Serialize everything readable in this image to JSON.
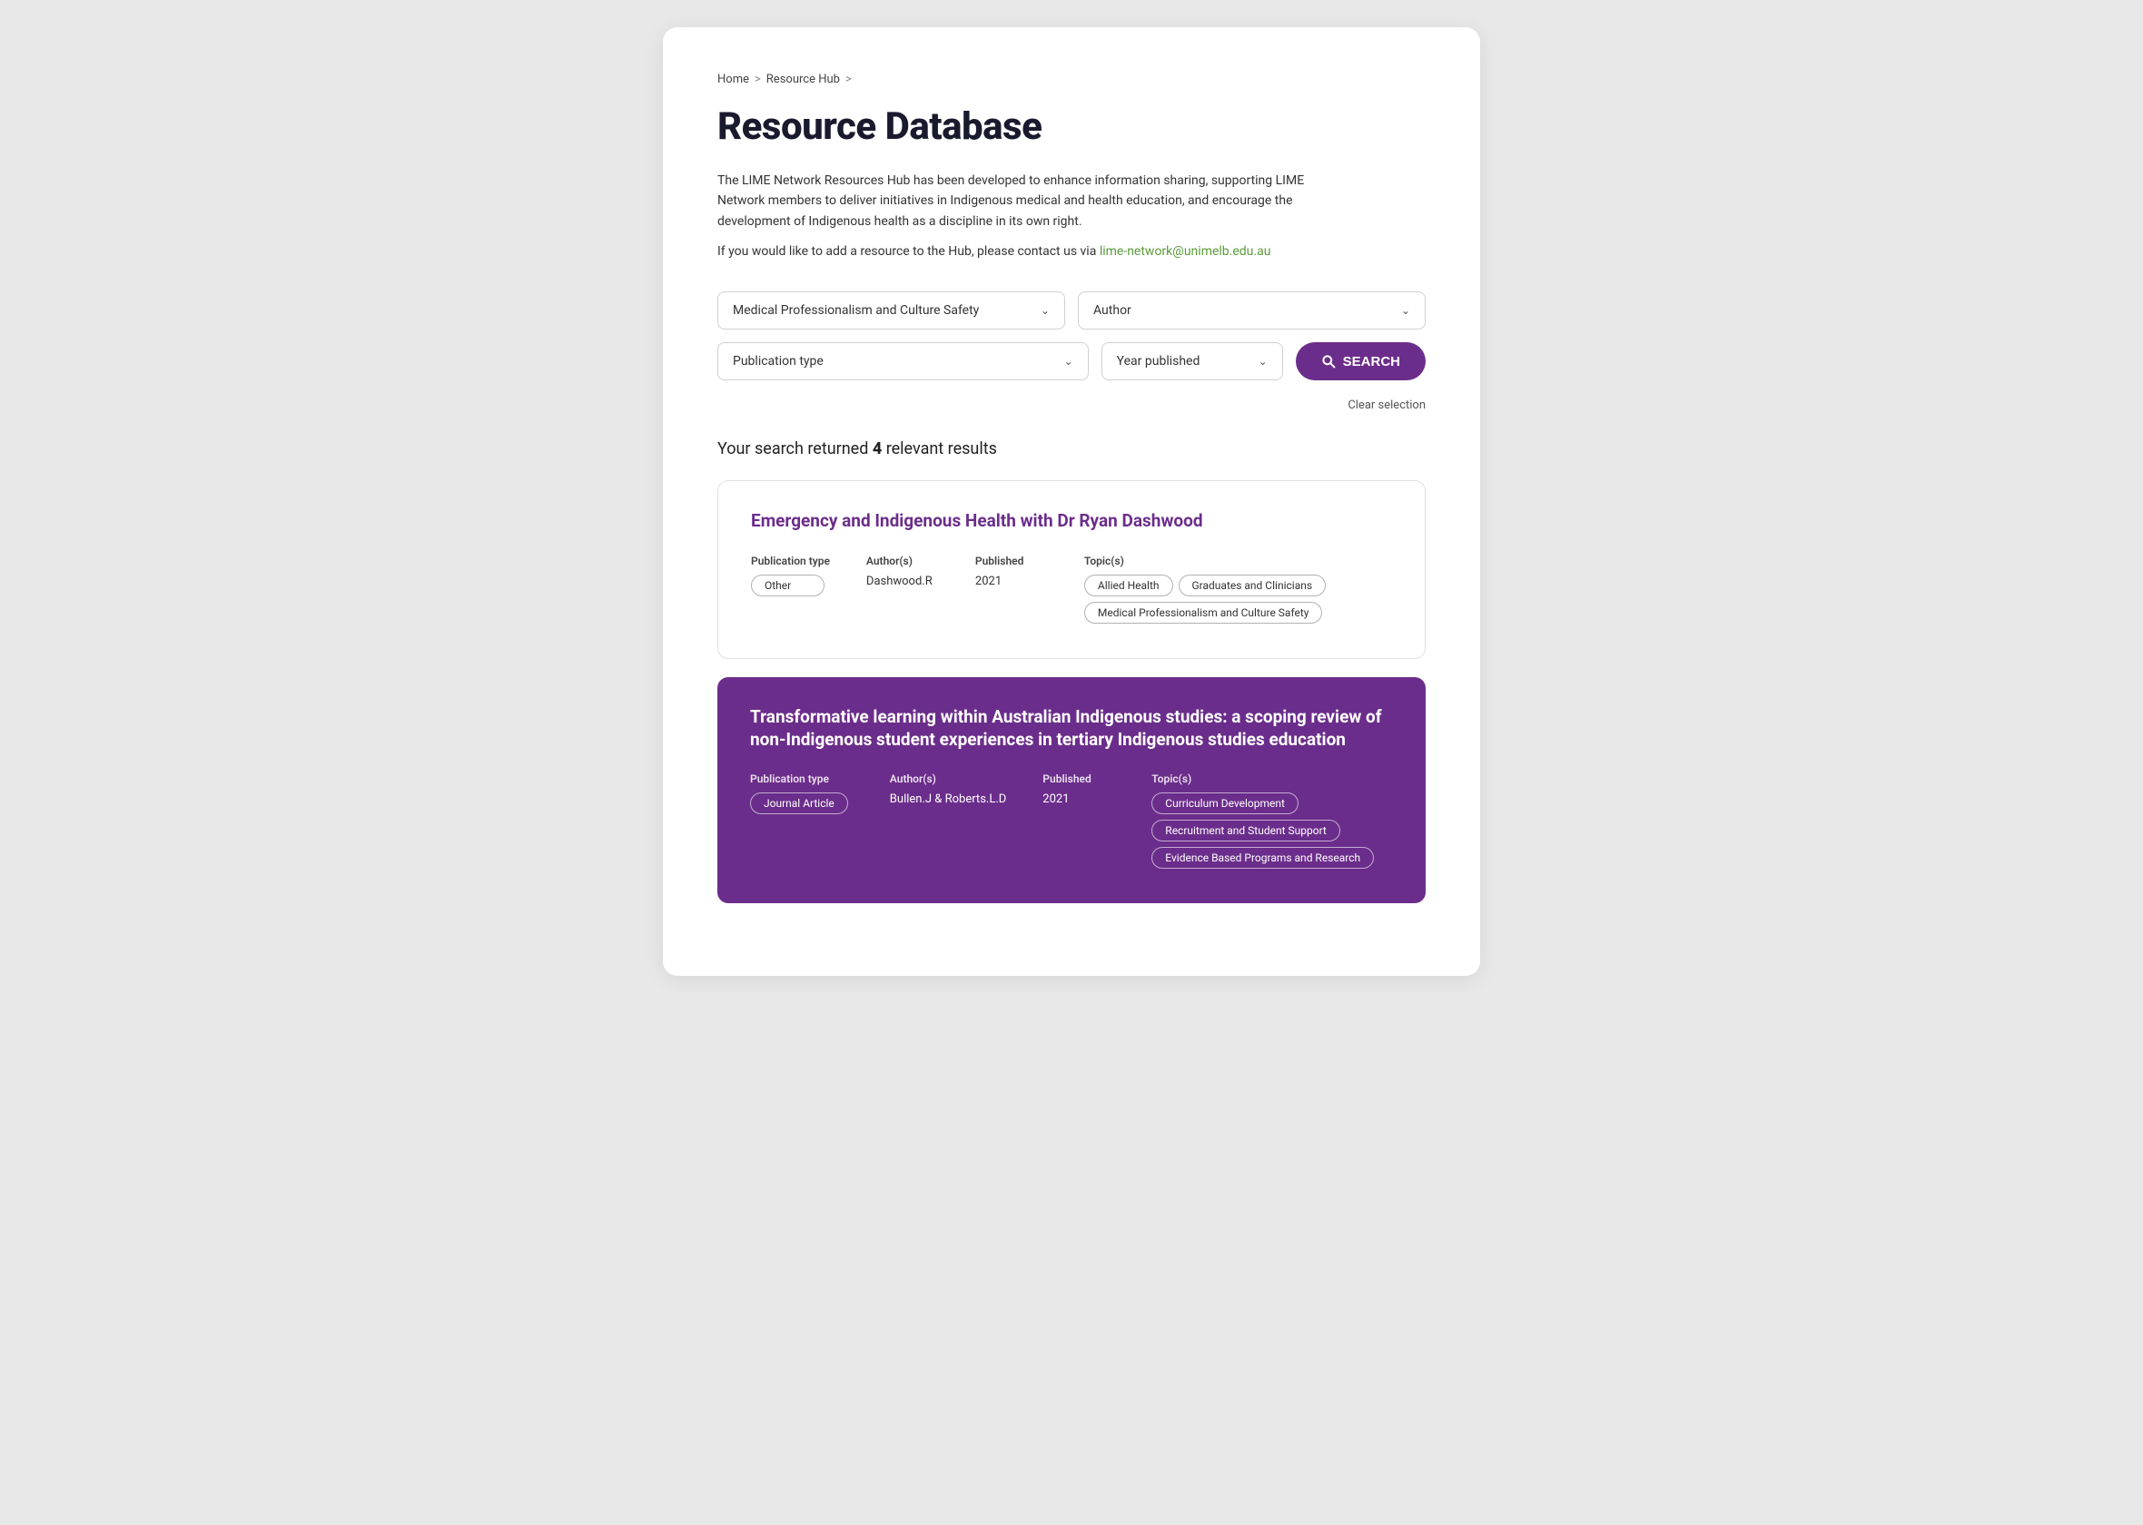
{
  "breadcrumb": {
    "home": "Home",
    "sep1": ">",
    "resource_hub": "Resource Hub",
    "sep2": ">"
  },
  "page": {
    "title": "Resource Database",
    "description": "The LIME Network Resources Hub has been developed to enhance information sharing, supporting LIME Network members to deliver initiatives in Indigenous medical and health education, and encourage the development of Indigenous health as a discipline in its own right.",
    "contact_text": "If you would like to add a resource to the Hub, please contact us via",
    "contact_email": "lime-network@unimelb.edu.au",
    "results_prefix": "Your search returned ",
    "results_count": "4",
    "results_suffix": " relevant results",
    "clear_label": "Clear selection"
  },
  "filters": {
    "topic_placeholder": "Medical Professionalism and Culture Safety",
    "author_placeholder": "Author",
    "publication_type_placeholder": "Publication type",
    "year_placeholder": "Year published",
    "search_label": "SEARCH"
  },
  "results": [
    {
      "title": "Emergency and Indigenous Health with Dr Ryan Dashwood",
      "publication_type_label": "Publication type",
      "publication_type": "Other",
      "authors_label": "Author(s)",
      "authors": "Dashwood.R",
      "published_label": "Published",
      "published": "2021",
      "topics_label": "Topic(s)",
      "topics": [
        "Allied Health",
        "Graduates and Clinicians",
        "Medical Professionalism and Culture Safety"
      ],
      "dark": false
    },
    {
      "title": "Transformative learning within Australian Indigenous studies: a scoping review of non-Indigenous student experiences in tertiary Indigenous studies education",
      "publication_type_label": "Publication type",
      "publication_type": "Journal Article",
      "authors_label": "Author(s)",
      "authors": "Bullen.J & Roberts.L.D",
      "published_label": "Published",
      "published": "2021",
      "topics_label": "Topic(s)",
      "topics": [
        "Curriculum Development",
        "Recruitment and Student Support",
        "Evidence Based Programs and Research"
      ],
      "dark": true
    }
  ]
}
